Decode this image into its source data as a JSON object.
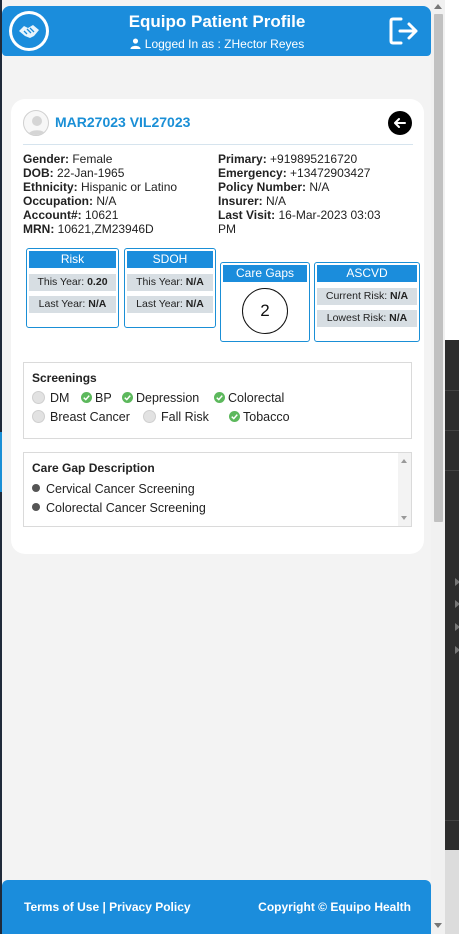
{
  "header": {
    "title": "Equipo Patient Profile",
    "logged_in": "Logged In as : ZHector Reyes"
  },
  "patient": {
    "name": "MAR27023 VIL27023",
    "left": [
      {
        "label": "Gender:",
        "value": " Female"
      },
      {
        "label": "DOB:",
        "value": " 22-Jan-1965"
      },
      {
        "label": "Ethnicity:",
        "value": " Hispanic or Latino"
      },
      {
        "label": "Occupation:",
        "value": " N/A"
      },
      {
        "label": "Account#:",
        "value": " 10621"
      },
      {
        "label": "MRN:",
        "value": " 10621,ZM23946D"
      }
    ],
    "right": [
      {
        "label": "Primary:",
        "value": " +919895216720"
      },
      {
        "label": "Emergency:",
        "value": " +13472903427"
      },
      {
        "label": "Policy Number:",
        "value": " N/A"
      },
      {
        "label": "Insurer:",
        "value": " N/A"
      },
      {
        "label": "Last Visit:",
        "value": " 16-Mar-2023 03:03 PM"
      }
    ]
  },
  "risk": {
    "title": "Risk",
    "this_year_label": "This Year: ",
    "this_year": "0.20",
    "last_year_label": "Last Year: ",
    "last_year": "N/A"
  },
  "sdoh": {
    "title": "SDOH",
    "this_year_label": "This Year: ",
    "this_year": "N/A",
    "last_year_label": "Last Year: ",
    "last_year": "N/A"
  },
  "care_gaps": {
    "title": "Care Gaps",
    "count": "2"
  },
  "ascvd": {
    "title": "ASCVD",
    "current_label": "Current Risk: ",
    "current": "N/A",
    "lowest_label": "Lowest Risk: ",
    "lowest": "N/A"
  },
  "screenings": {
    "title": "Screenings",
    "items": [
      {
        "label": "DM",
        "done": false
      },
      {
        "label": "BP",
        "done": true
      },
      {
        "label": "Depression",
        "done": true
      },
      {
        "label": "Colorectal",
        "done": true
      },
      {
        "label": "Breast Cancer",
        "done": false
      },
      {
        "label": "Fall Risk",
        "done": false
      },
      {
        "label": "Tobacco",
        "done": true
      }
    ]
  },
  "care_gap_description": {
    "title": "Care Gap Description",
    "items": [
      "Cervical Cancer Screening",
      "Colorectal Cancer Screening"
    ]
  },
  "footer": {
    "terms": "Terms of Use",
    "divider": " | ",
    "privacy": "Privacy Policy",
    "copyright": "Copyright © Equipo Health"
  },
  "colors": {
    "primary": "#1b8ddc",
    "check": "#5cb85c",
    "panel_bg": "#f3f3f3"
  }
}
